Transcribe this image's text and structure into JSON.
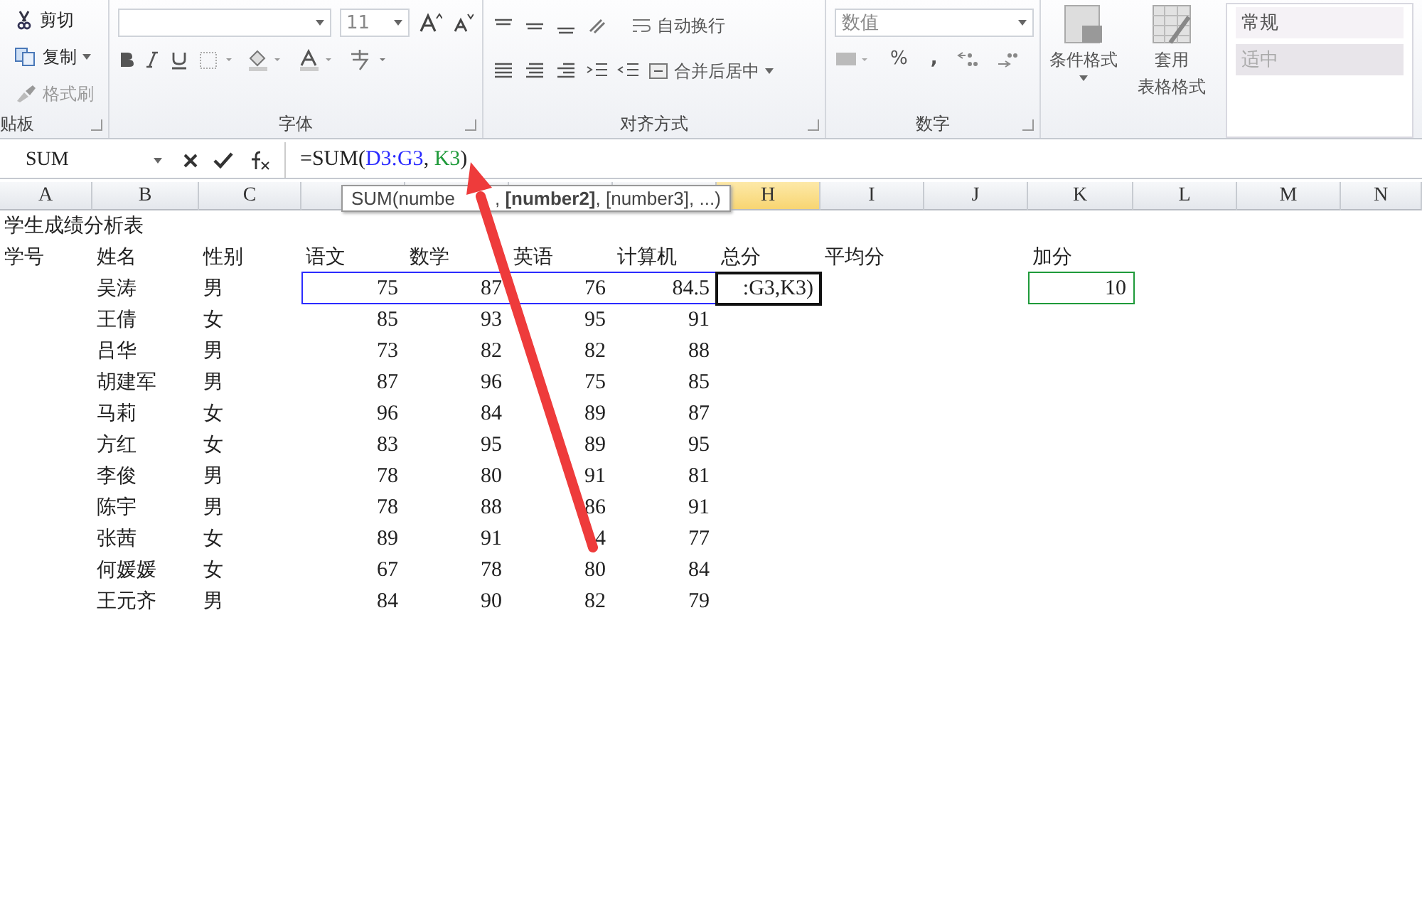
{
  "ribbon": {
    "clipboard": {
      "items": [
        {
          "kind": "cut",
          "label": "剪切",
          "dropdown": false,
          "disabled": false
        },
        {
          "kind": "copy",
          "label": "复制",
          "dropdown": true,
          "disabled": false
        },
        {
          "kind": "painter",
          "label": "格式刷",
          "dropdown": false,
          "disabled": true
        }
      ],
      "label": "贴板"
    },
    "font": {
      "size": "11",
      "label": "字体"
    },
    "alignment": {
      "wrap": "自动换行",
      "merge": "合并后居中",
      "label": "对齐方式"
    },
    "number": {
      "format": "数值",
      "percent": "%",
      "comma": ",",
      "label": "数字"
    },
    "styles": {
      "conditional": "条件格式",
      "table": [
        "套用",
        "表格格式"
      ],
      "cells": [
        "常规",
        "适中"
      ]
    }
  },
  "formula_bar": {
    "name_box": "SUM",
    "formula": [
      {
        "text": "=SUM("
      },
      {
        "text": "D3:G3",
        "color": "#2b2bff"
      },
      {
        "text": ", "
      },
      {
        "text": "K3",
        "color": "#1f9a3a"
      },
      {
        "text": ")"
      }
    ],
    "tooltip": [
      "SUM(numbe",
      ", **[number2]**, [number3], ...)"
    ]
  },
  "sheet": {
    "columns": [
      {
        "label": "A",
        "selected": false
      },
      {
        "label": "B",
        "selected": false
      },
      {
        "label": "C",
        "selected": false
      },
      {
        "selected": false
      },
      {
        "selected": false
      },
      {
        "selected": false
      },
      {
        "selected": false
      },
      {
        "label": "H",
        "selected": true
      },
      {
        "label": "I",
        "selected": false
      },
      {
        "label": "J",
        "selected": false
      },
      {
        "label": "K",
        "selected": false
      },
      {
        "label": "L",
        "selected": false
      },
      {
        "label": "M",
        "selected": false
      },
      {
        "label": "N",
        "selected": false
      }
    ],
    "rows": [
      {
        "kind": "title",
        "cells": [
          "学生成绩分析表"
        ]
      },
      {
        "kind": "header",
        "cells": [
          "学号",
          "姓名",
          "性别",
          "语文",
          "数学",
          "英语",
          "计算机",
          "总分",
          "平均分",
          "",
          "加分"
        ]
      },
      {
        "kind": "data",
        "cells": [
          "",
          "吴涛",
          "男",
          {
            "text": "75",
            "color": "#2b2bff"
          },
          {
            "text": "87",
            "color": "#2b2bff"
          },
          {
            "text": "76",
            "color": "#2b2bff"
          },
          {
            "text": "84.5",
            "color": "#2b2bff"
          },
          {
            "text": ":G3,K3)",
            "active": true
          },
          "",
          "",
          {
            "text": "10",
            "color": "#1f9a3a"
          }
        ]
      },
      {
        "kind": "data",
        "cells": [
          "",
          "王倩",
          "女",
          "85",
          "93",
          "95",
          "91"
        ]
      },
      {
        "kind": "data",
        "cells": [
          "",
          "吕华",
          "男",
          "73",
          "82",
          "82",
          "88"
        ]
      },
      {
        "kind": "data",
        "cells": [
          "",
          "胡建军",
          "男",
          "87",
          "96",
          "75",
          "85"
        ]
      },
      {
        "kind": "data",
        "cells": [
          "",
          "马莉",
          "女",
          "96",
          "84",
          "89",
          "87"
        ]
      },
      {
        "kind": "data",
        "cells": [
          "",
          "方红",
          "女",
          "83",
          "95",
          "89",
          "95"
        ]
      },
      {
        "kind": "data",
        "cells": [
          "",
          "李俊",
          "男",
          "78",
          "80",
          "91",
          "81"
        ]
      },
      {
        "kind": "data",
        "cells": [
          "",
          "陈宇",
          "男",
          "78",
          "88",
          "86",
          "91"
        ]
      },
      {
        "kind": "data",
        "cells": [
          "",
          "张茜",
          "女",
          "89",
          "91",
          "4",
          "77"
        ]
      },
      {
        "kind": "data",
        "cells": [
          "",
          "何媛媛",
          "女",
          "67",
          "78",
          "80",
          "84"
        ]
      },
      {
        "kind": "data",
        "cells": [
          "",
          "王元齐",
          "男",
          "84",
          "90",
          "82",
          "79"
        ]
      }
    ]
  }
}
